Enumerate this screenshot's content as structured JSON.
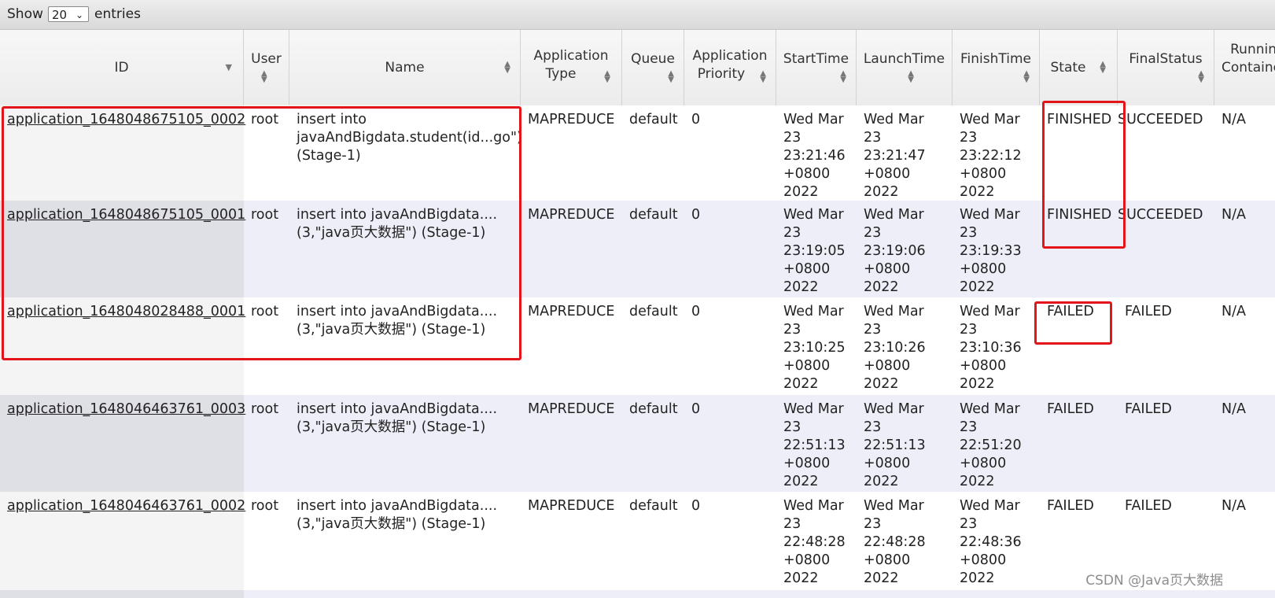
{
  "controls": {
    "show_label": "Show",
    "page_size": "20",
    "entries_label": "entries"
  },
  "columns": {
    "id": "ID",
    "user": "User",
    "name": "Name",
    "app_type_l1": "Application",
    "app_type_l2": "Type",
    "queue": "Queue",
    "priority_l1": "Application",
    "priority_l2": "Priority",
    "start": "StartTime",
    "launch": "LaunchTime",
    "finish": "FinishTime",
    "state": "State",
    "final_status": "FinalStatus",
    "running_l1": "Running",
    "running_l2": "Containers"
  },
  "rows": [
    {
      "id": "application_1648048675105_0002",
      "user": "root",
      "name": "insert into javaAndBigdata.student(id...go\") (Stage-1)",
      "type": "MAPREDUCE",
      "queue": "default",
      "priority": "0",
      "start": "Wed Mar 23 23:21:46 +0800 2022",
      "launch": "Wed Mar 23 23:21:47 +0800 2022",
      "finish": "Wed Mar 23 23:22:12 +0800 2022",
      "state": "FINISHED",
      "final_status": "SUCCEEDED",
      "running": "N/A"
    },
    {
      "id": "application_1648048675105_0001",
      "user": "root",
      "name": "insert into javaAndBigdata.... (3,\"java页大数据\") (Stage-1)",
      "type": "MAPREDUCE",
      "queue": "default",
      "priority": "0",
      "start": "Wed Mar 23 23:19:05 +0800 2022",
      "launch": "Wed Mar 23 23:19:06 +0800 2022",
      "finish": "Wed Mar 23 23:19:33 +0800 2022",
      "state": "FINISHED",
      "final_status": "SUCCEEDED",
      "running": "N/A"
    },
    {
      "id": "application_1648048028488_0001",
      "user": "root",
      "name": "insert into javaAndBigdata.... (3,\"java页大数据\") (Stage-1)",
      "type": "MAPREDUCE",
      "queue": "default",
      "priority": "0",
      "start": "Wed Mar 23 23:10:25 +0800 2022",
      "launch": "Wed Mar 23 23:10:26 +0800 2022",
      "finish": "Wed Mar 23 23:10:36 +0800 2022",
      "state": "FAILED",
      "final_status": "FAILED",
      "running": "N/A"
    },
    {
      "id": "application_1648046463761_0003",
      "user": "root",
      "name": "insert into javaAndBigdata.... (3,\"java页大数据\") (Stage-1)",
      "type": "MAPREDUCE",
      "queue": "default",
      "priority": "0",
      "start": "Wed Mar 23 22:51:13 +0800 2022",
      "launch": "Wed Mar 23 22:51:13 +0800 2022",
      "finish": "Wed Mar 23 22:51:20 +0800 2022",
      "state": "FAILED",
      "final_status": "FAILED",
      "running": "N/A"
    },
    {
      "id": "application_1648046463761_0002",
      "user": "root",
      "name": "insert into javaAndBigdata.... (3,\"java页大数据\") (Stage-1)",
      "type": "MAPREDUCE",
      "queue": "default",
      "priority": "0",
      "start": "Wed Mar 23 22:48:28 +0800 2022",
      "launch": "Wed Mar 23 22:48:28 +0800 2022",
      "finish": "Wed Mar 23 22:48:36 +0800 2022",
      "state": "FAILED",
      "final_status": "FAILED",
      "running": "N/A"
    }
  ],
  "watermark": "CSDN @Java页大数据",
  "highlight_color": "#e4141b"
}
